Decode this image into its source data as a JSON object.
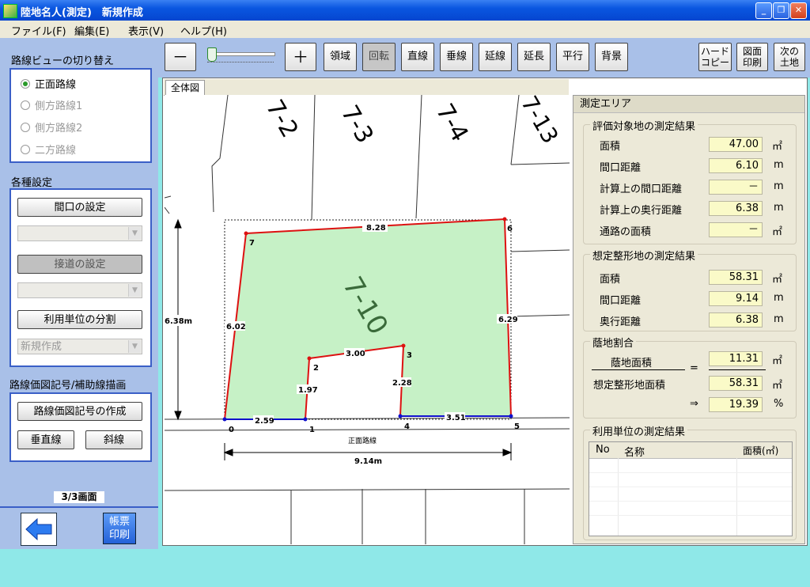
{
  "window": {
    "title": "陸地名人(測定)　新規作成"
  },
  "menu": [
    "ファイル(F)",
    "編集(E)",
    "表示(V)",
    "ヘルプ(H)"
  ],
  "left": {
    "route_view_title": "路線ビューの切り替え",
    "routes": [
      {
        "label": "正面路線",
        "selected": true
      },
      {
        "label": "側方路線1",
        "selected": false
      },
      {
        "label": "側方路線2",
        "selected": false
      },
      {
        "label": "二方路線",
        "selected": false
      }
    ],
    "settings_title": "各種設定",
    "frontage_button": "間口の設定",
    "road_button": "接道の設定",
    "split_button": "利用単位の分割",
    "new_combo": "新規作成",
    "route_price_title": "路線価図記号/補助線描画",
    "create_symbol_button": "路線価図記号の作成",
    "vertical_button": "垂直線",
    "diagonal_button": "斜線",
    "page_indicator": "3/3画面",
    "print_button": [
      "帳票",
      "印刷"
    ]
  },
  "toolbar": {
    "minus": "－",
    "plus": "＋",
    "buttons": [
      "領域",
      "回転",
      "直線",
      "垂線",
      "延線",
      "延長",
      "平行",
      "背景"
    ],
    "hardcopy": [
      "ハード",
      "コピー"
    ],
    "print_drawing": [
      "図面",
      "印刷"
    ],
    "next_land": [
      "次の",
      "土地"
    ]
  },
  "tab": "全体図",
  "drawing": {
    "parcels": [
      "7-2",
      "7-3",
      "7-4",
      "7-13",
      "7-10"
    ],
    "point_labels": [
      "0",
      "1",
      "2",
      "3",
      "4",
      "5",
      "6",
      "7"
    ],
    "edge_labels": [
      "8.28",
      "6.02",
      "6.29",
      "3.00",
      "1.97",
      "2.28",
      "2.59",
      "3.51"
    ],
    "route_label": "正面路線",
    "width_dimension": "9.14m",
    "depth_dimension": "6.38m"
  },
  "measure": {
    "title": "測定エリア",
    "target": {
      "title": "評価対象地の測定結果",
      "rows": [
        {
          "label": "面積",
          "value": "47.00",
          "unit": "㎡"
        },
        {
          "label": "間口距離",
          "value": "6.10",
          "unit": "m"
        },
        {
          "label": "計算上の間口距離",
          "value": "－",
          "unit": "m"
        },
        {
          "label": "計算上の奥行距離",
          "value": "6.38",
          "unit": "m"
        },
        {
          "label": "通路の面積",
          "value": "－",
          "unit": "㎡"
        }
      ]
    },
    "assumed": {
      "title": "想定整形地の測定結果",
      "rows": [
        {
          "label": "面積",
          "value": "58.31",
          "unit": "㎡"
        },
        {
          "label": "間口距離",
          "value": "9.14",
          "unit": "m"
        },
        {
          "label": "奥行距離",
          "value": "6.38",
          "unit": "m"
        }
      ]
    },
    "ratio": {
      "title": "蔭地割合",
      "numerator_label": "蔭地面積",
      "numerator_value": "11.31",
      "numerator_unit": "㎡",
      "equals": "=",
      "denominator_label": "想定整形地面積",
      "denominator_value": "58.31",
      "denominator_unit": "㎡",
      "arrow": "⇒",
      "result_value": "19.39",
      "result_unit": "%"
    },
    "units": {
      "title": "利用単位の測定結果",
      "columns": [
        "No",
        "名称",
        "面積(㎡)"
      ]
    }
  }
}
